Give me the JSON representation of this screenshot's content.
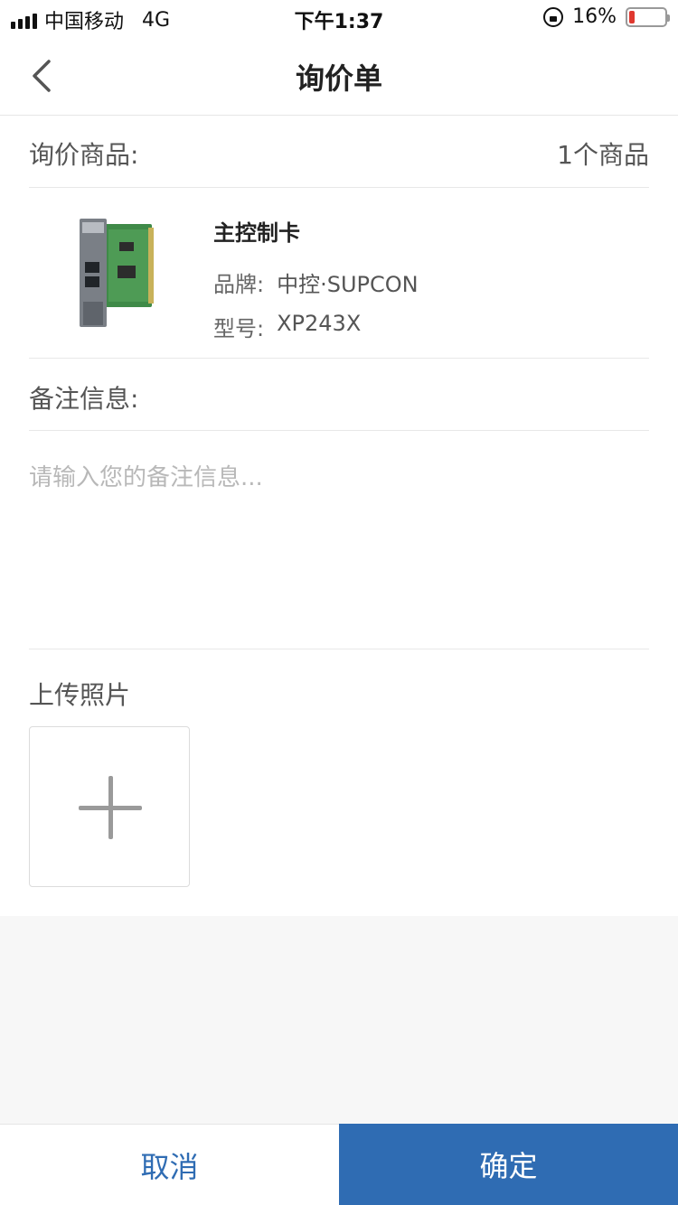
{
  "status_bar": {
    "carrier": "中国移动",
    "network": "4G",
    "time": "下午1:37",
    "battery_text": "16%",
    "battery_level": 0.16,
    "battery_color": "#e0382f"
  },
  "nav": {
    "title": "询价单",
    "back_icon": "chevron-left-icon"
  },
  "inquiry": {
    "label": "询价商品:",
    "count": "1个商品"
  },
  "product": {
    "name": "主控制卡",
    "brand_label": "品牌:",
    "brand": "中控·SUPCON",
    "model_label": "型号:",
    "model": "XP243X"
  },
  "remark": {
    "label": "备注信息:",
    "placeholder": "请输入您的备注信息...",
    "value": ""
  },
  "upload": {
    "title": "上传照片",
    "icon": "plus-icon"
  },
  "actions": {
    "cancel": "取消",
    "confirm": "确定"
  },
  "colors": {
    "accent": "#2f6cb3"
  }
}
